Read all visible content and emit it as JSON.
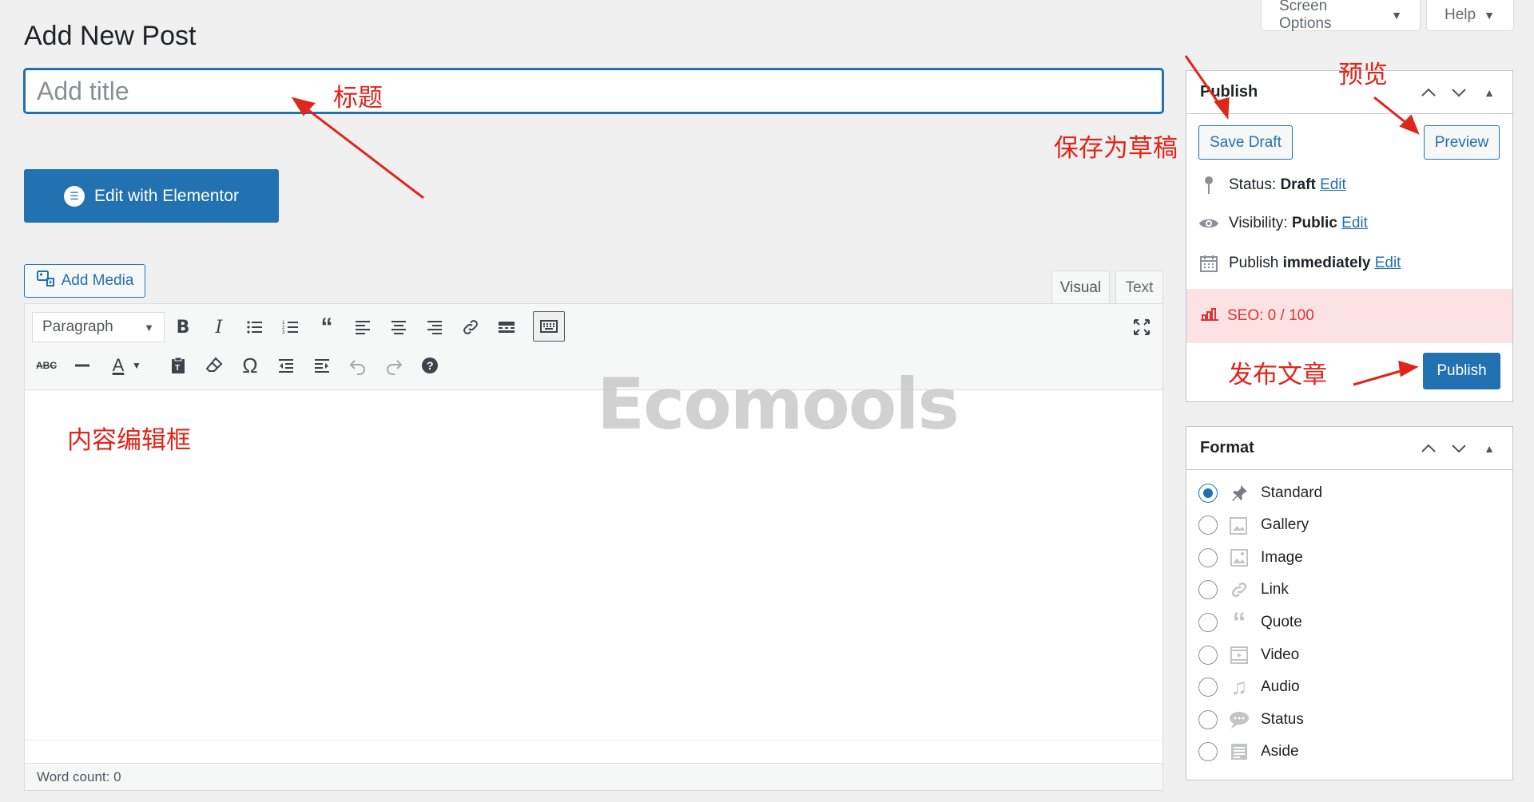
{
  "header": {
    "page_title": "Add New Post",
    "screen_options_label": "Screen Options",
    "help_label": "Help"
  },
  "title_field": {
    "placeholder": "Add title",
    "value": ""
  },
  "elementor_button": "Edit with Elementor",
  "editor": {
    "add_media_label": "Add Media",
    "tabs": [
      {
        "label": "Visual",
        "active": true
      },
      {
        "label": "Text",
        "active": false
      }
    ],
    "format_select": "Paragraph",
    "word_count": "Word count: 0"
  },
  "publish_box": {
    "title": "Publish",
    "save_draft_label": "Save Draft",
    "preview_label": "Preview",
    "status_label": "Status:",
    "status_value": "Draft",
    "visibility_label": "Visibility:",
    "visibility_value": "Public",
    "publish_label": "Publish",
    "publish_value": "immediately",
    "edit_link": "Edit",
    "seo_label": "SEO: 0 / 100",
    "publish_button": "Publish"
  },
  "format_box": {
    "title": "Format",
    "options": [
      {
        "label": "Standard",
        "icon": "pin-icon",
        "checked": true
      },
      {
        "label": "Gallery",
        "icon": "gallery-icon",
        "checked": false
      },
      {
        "label": "Image",
        "icon": "image-icon",
        "checked": false
      },
      {
        "label": "Link",
        "icon": "link-icon",
        "checked": false
      },
      {
        "label": "Quote",
        "icon": "quote-icon",
        "checked": false
      },
      {
        "label": "Video",
        "icon": "video-icon",
        "checked": false
      },
      {
        "label": "Audio",
        "icon": "audio-icon",
        "checked": false
      },
      {
        "label": "Status",
        "icon": "status-icon",
        "checked": false
      },
      {
        "label": "Aside",
        "icon": "aside-icon",
        "checked": false
      }
    ]
  },
  "annotations": {
    "title": "标题",
    "save_draft": "保存为草稿",
    "preview": "预览",
    "publish": "发布文章",
    "content": "内容编辑框"
  },
  "watermark": "Ecomools",
  "colors": {
    "accent": "#2271b1",
    "annotation": "#e0251b",
    "seo_bg": "#fde2e3"
  }
}
